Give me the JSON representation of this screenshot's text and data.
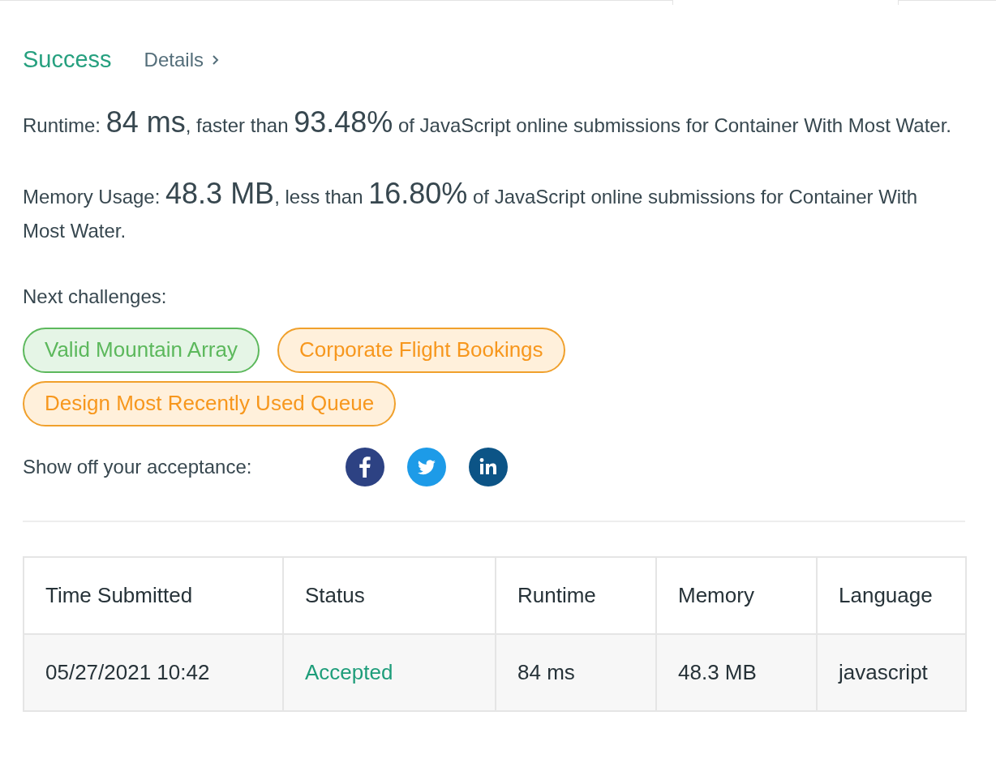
{
  "result": {
    "status": "Success",
    "details_link": "Details"
  },
  "runtime": {
    "label": "Runtime: ",
    "value": "84 ms",
    "mid": ", faster than ",
    "percent": "93.48%",
    "tail": " of JavaScript online submissions for Container With Most Water."
  },
  "memory": {
    "label": "Memory Usage: ",
    "value": "48.3 MB",
    "mid": ", less than ",
    "percent": "16.80%",
    "tail": " of JavaScript online submissions for Container With Most Water."
  },
  "next_challenges": {
    "label": "Next challenges:",
    "items": [
      {
        "label": "Valid Mountain Array",
        "kind": "easy"
      },
      {
        "label": "Corporate Flight Bookings",
        "kind": "medium"
      },
      {
        "label": "Design Most Recently Used Queue",
        "kind": "medium"
      }
    ]
  },
  "share": {
    "label": "Show off your acceptance:",
    "networks": [
      {
        "kind": "facebook"
      },
      {
        "kind": "twitter"
      },
      {
        "kind": "linkedin"
      }
    ]
  },
  "table": {
    "columns": [
      "Time Submitted",
      "Status",
      "Runtime",
      "Memory",
      "Language"
    ],
    "rows": [
      {
        "cells": [
          "05/27/2021 10:42",
          "Accepted",
          "84 ms",
          "48.3 MB",
          "javascript"
        ],
        "kind": "accepted"
      }
    ]
  }
}
